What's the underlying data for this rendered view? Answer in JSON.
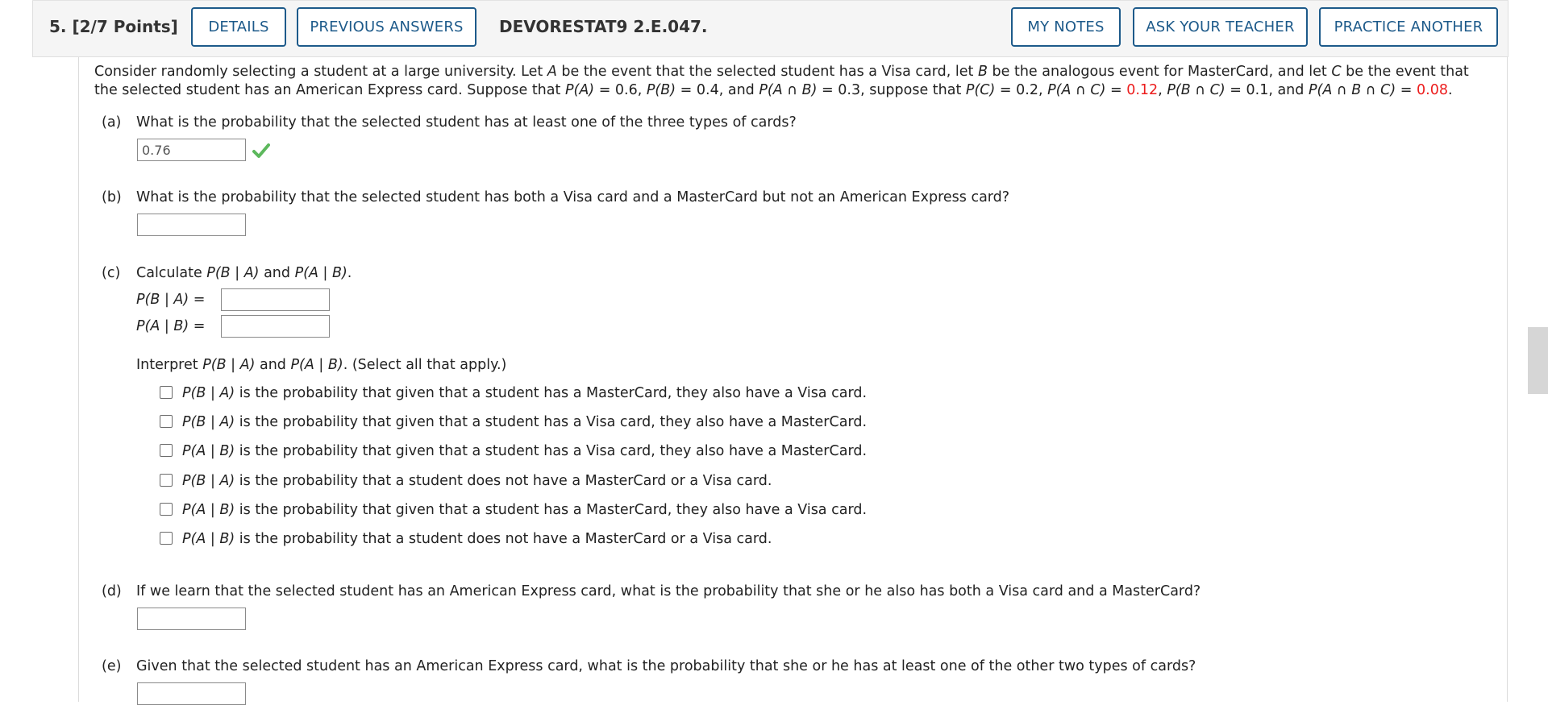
{
  "header": {
    "question_number": "5.  [2/7 Points]",
    "details_label": "DETAILS",
    "previous_answers_label": "PREVIOUS ANSWERS",
    "assignment_code": "DEVORESTAT9 2.E.047.",
    "my_notes_label": "MY NOTES",
    "ask_teacher_label": "ASK YOUR TEACHER",
    "practice_another_label": "PRACTICE ANOTHER"
  },
  "intro": {
    "t1": "Consider randomly selecting a student at a large university. Let ",
    "A": "A",
    "t2": " be the event that the selected student has a Visa card, let ",
    "B": "B",
    "t3": " be the analogous event for MasterCard, and let ",
    "C": "C",
    "t4": " be the event that the selected student has an American Express card. Suppose that ",
    "pA": "P(A)",
    "t5": " = 0.6, ",
    "pB": "P(B)",
    "t6": " = 0.4, and ",
    "pAB": "P(A ∩ B)",
    "t7": " = 0.3, suppose that ",
    "pC": "P(C)",
    "t8": " = 0.2, ",
    "pAC": "P(A ∩ C)",
    "t9": " = ",
    "v_AC": "0.12",
    "t10": ", ",
    "pBC": "P(B ∩ C)",
    "t11": " = 0.1, and ",
    "pABC": "P(A ∩ B ∩ C)",
    "t12": " = ",
    "v_ABC": "0.08",
    "t13": "."
  },
  "parts": {
    "a": {
      "letter": "(a)",
      "question": "What is the probability that the selected student has at least one of the three types of cards?",
      "answer": "0.76"
    },
    "b": {
      "letter": "(b)",
      "question": "What is the probability that the selected student has both a Visa card and a MasterCard but not an American Express card?",
      "answer": ""
    },
    "c": {
      "letter": "(c)",
      "q_calc": "Calculate ",
      "q_pBA": "P(B | A)",
      "q_and": " and ",
      "q_pAB": "P(A | B)",
      "q_end": ".",
      "label_BA": "P(B | A)",
      "label_AB": "P(A | B)",
      "equals": "=",
      "interpret_prefix": "Interpret ",
      "interpret_pBA": "P(B | A)",
      "interpret_and": " and ",
      "interpret_pAB": "P(A | B)",
      "interpret_suffix": ". (Select all that apply.)",
      "options": [
        {
          "prob": "P(B | A)",
          "text": " is the probability that given that a student has a MasterCard, they also have a Visa card."
        },
        {
          "prob": "P(B | A)",
          "text": " is the probability that given that a student has a Visa card, they also have a MasterCard."
        },
        {
          "prob": "P(A | B)",
          "text": " is the probability that given that a student has a Visa card, they also have a MasterCard."
        },
        {
          "prob": "P(B | A)",
          "text": " is the probability that a student does not have a MasterCard or a Visa card."
        },
        {
          "prob": "P(A | B)",
          "text": " is the probability that given that a student has a MasterCard, they also have a Visa card."
        },
        {
          "prob": "P(A | B)",
          "text": " is the probability that a student does not have a MasterCard or a Visa card."
        }
      ]
    },
    "d": {
      "letter": "(d)",
      "question": "If we learn that the selected student has an American Express card, what is the probability that she or he also has both a Visa card and a MasterCard?",
      "answer": ""
    },
    "e": {
      "letter": "(e)",
      "question": "Given that the selected student has an American Express card, what is the probability that she or he has at least one of the other two types of cards?"
    }
  },
  "colors": {
    "accent": "#1d5a8a",
    "correct": "#5cb85c",
    "highlight": "#ec1c1c"
  },
  "icons": {
    "correct": "check-icon"
  }
}
